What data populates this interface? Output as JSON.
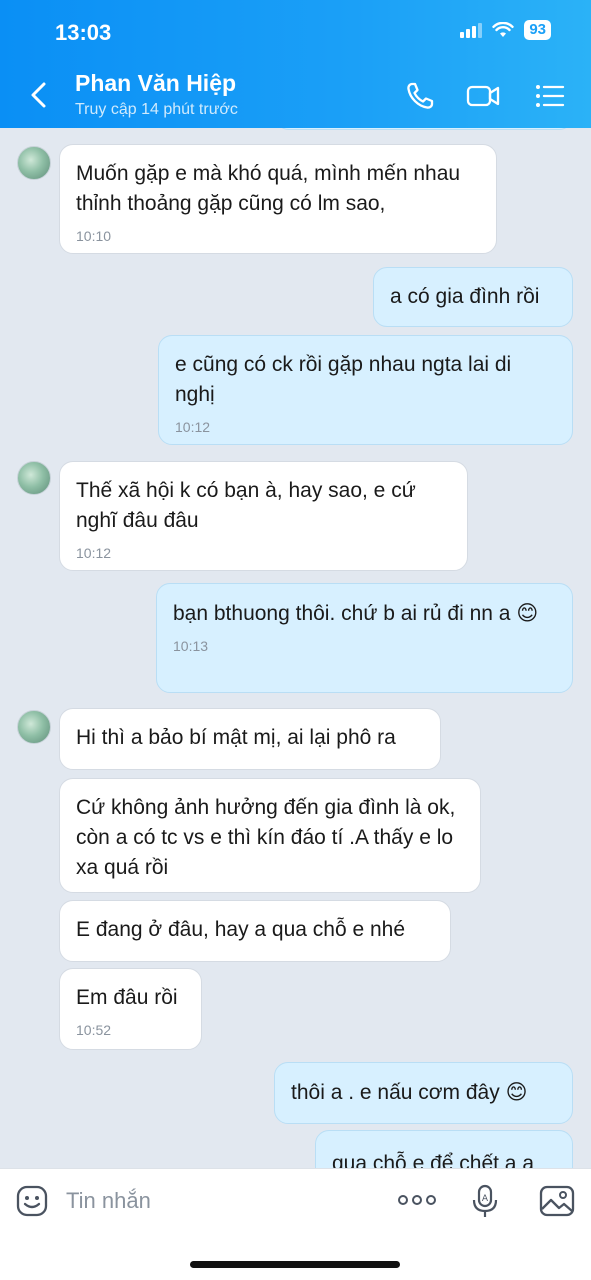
{
  "status_bar": {
    "time": "13:03",
    "battery": "93"
  },
  "header": {
    "contact_name": "Phan Văn Hiệp",
    "contact_status": "Truy cập 14 phút trước",
    "icons": [
      "back-icon",
      "phone-icon",
      "video-call-icon",
      "menu-list-icon"
    ]
  },
  "messages": [
    {
      "dir": "in",
      "text": "Muốn gặp e mà khó quá,  mình mến nhau thỉnh thoảng gặp cũng có lm sao,",
      "time": "10:10"
    },
    {
      "dir": "out",
      "text": "a có gia đình rồi",
      "time": ""
    },
    {
      "dir": "out",
      "text": "e cũng có ck rồi gặp nhau ngta lai di nghị",
      "time": "10:12"
    },
    {
      "dir": "in",
      "text": "Thế xã hội k có bạn à, hay sao, e cứ nghĩ đâu đâu",
      "time": "10:12"
    },
    {
      "dir": "out",
      "text": "bạn bthuong thôi. chứ b ai rủ đi nn a",
      "emoji": "😊",
      "time": "10:13"
    },
    {
      "dir": "in",
      "text": "Hi thì a bảo bí mật mị, ai lại phô ra",
      "time": ""
    },
    {
      "dir": "in",
      "text": "Cứ không ảnh hưởng đến gia đình  là ok, còn a có tc vs e thì kín đáo tí  .A thấy e lo xa quá rồi",
      "time": ""
    },
    {
      "dir": "in",
      "text": "E đang ở đâu, hay a qua chỗ e nhé",
      "time": ""
    },
    {
      "dir": "in",
      "text": "Em đâu rồi",
      "time": "10:52"
    },
    {
      "dir": "out",
      "text": "thôi a . e nấu cơm đây",
      "emoji": "😊",
      "time": ""
    },
    {
      "dir": "out",
      "text": "qua chỗ e để chết a a",
      "time": ""
    }
  ],
  "input": {
    "placeholder": "Tin nhắn"
  },
  "colors": {
    "header_start": "#0a8ff5",
    "header_end": "#2bb2f7",
    "outgoing_bubble": "#d7f0ff",
    "incoming_bubble": "#ffffff",
    "chat_bg": "#e2e8f0"
  }
}
